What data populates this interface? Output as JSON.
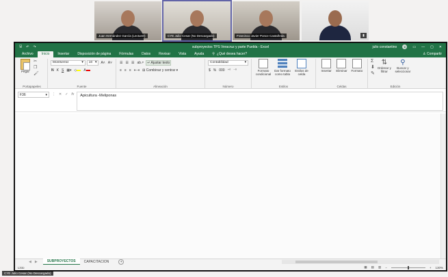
{
  "meeting": {
    "participants": [
      {
        "name": "Juan Hernández García (Lecturer)",
        "muted": false
      },
      {
        "name": "CYE Julio Cesar (No Descargado)",
        "muted": false
      },
      {
        "name": "Francisco Javier Ponce Castañeda",
        "muted": false
      },
      {
        "name": "",
        "muted": true
      }
    ],
    "presenter_label": "CYE Julio Cesar (No Descargado)"
  },
  "excel": {
    "window_title": "subproyectos TPS Veracruz y parte Puebla - Excel",
    "user": "julio constantino",
    "accent": "#217346",
    "qat": {
      "save": "🖫",
      "undo": "↶",
      "redo": "↷"
    },
    "window_controls": {
      "min": "—",
      "max": "▢",
      "close": "✕",
      "ribbon_opts": "▭"
    },
    "tabs": [
      "Archivo",
      "Inicio",
      "Insertar",
      "Disposición de página",
      "Fórmulas",
      "Datos",
      "Revisar",
      "Vista",
      "Ayuda"
    ],
    "active_tab": "Inicio",
    "tell_me": "¿Qué desea hacer?",
    "share": "Compartir",
    "ribbon": {
      "clipboard": {
        "label": "Portapapeles",
        "paste": "Pegar"
      },
      "font": {
        "label": "Fuente",
        "font_name": "Montserrat",
        "font_size": "10",
        "bold": "N",
        "italic": "K",
        "underline": "S"
      },
      "alignment": {
        "label": "Alineación",
        "wrap": "Ajustar texto",
        "merge": "Combinar y centrar"
      },
      "number": {
        "label": "Número",
        "format": "Contabilidad",
        "currency": "$",
        "percent": "%",
        "thousands": "000"
      },
      "styles": {
        "label": "Estilos",
        "conditional": "Formato condicional",
        "as_table": "Dar formato como tabla",
        "cell_styles": "Estilos de celda"
      },
      "cells": {
        "label": "Celdas",
        "insert": "Insertar",
        "delete": "Eliminar",
        "format": "Formato"
      },
      "editing": {
        "label": "Edición",
        "sort": "Ordenar y filtrar",
        "find": "Buscar y seleccionar"
      }
    },
    "formula_bar": {
      "name_box": "F36",
      "fx": "fx",
      "content": "Apicultura -Meliponas"
    },
    "sheets": [
      "SUBPROYECTOS",
      "CAPACITACION"
    ],
    "active_sheet": "SUBPROYECTOS",
    "status": {
      "left": "Listo",
      "zoom": "130%"
    }
  }
}
